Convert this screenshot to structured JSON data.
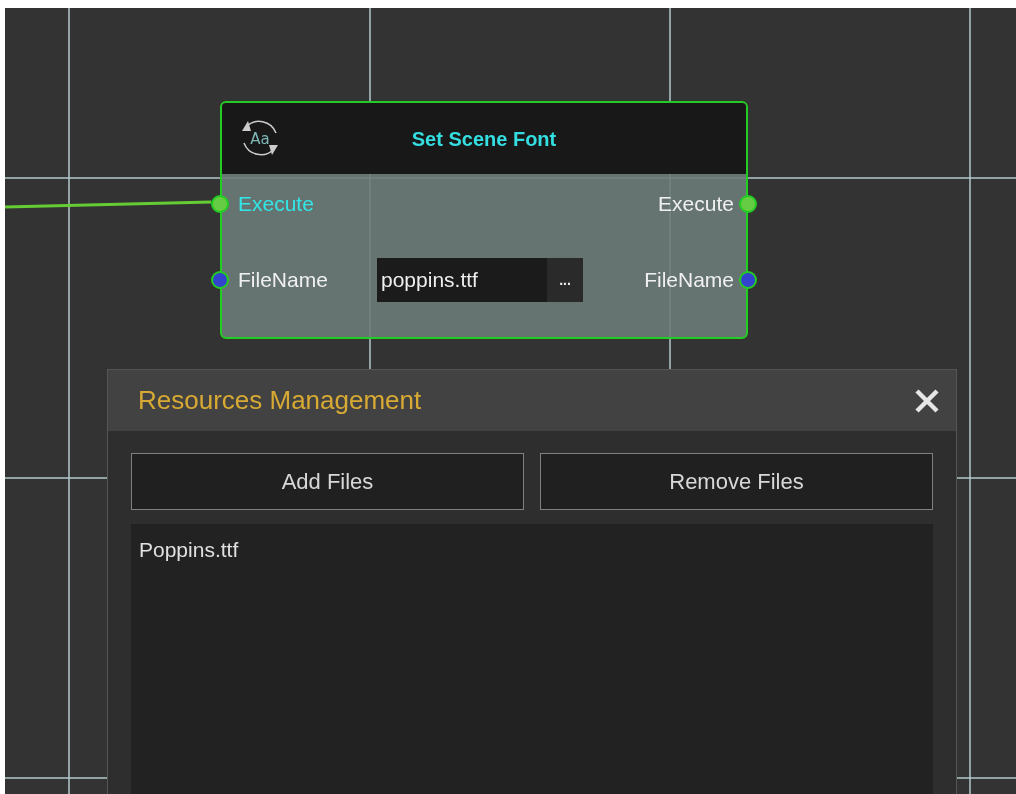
{
  "node": {
    "icon_text": "Aa",
    "title": "Set Scene Font",
    "inputs": [
      {
        "label": "Execute",
        "kind": "exec",
        "connected": true
      },
      {
        "label": "FileName",
        "kind": "data",
        "connected": false
      }
    ],
    "field": {
      "value": "poppins.ttf",
      "button": "..."
    },
    "outputs": [
      {
        "label": "Execute",
        "kind": "exec"
      },
      {
        "label": "FileName",
        "kind": "data"
      }
    ]
  },
  "dialog": {
    "title": "Resources Management",
    "buttons": [
      "Add Files",
      "Remove Files"
    ],
    "files": [
      "Poppins.ttf"
    ]
  }
}
